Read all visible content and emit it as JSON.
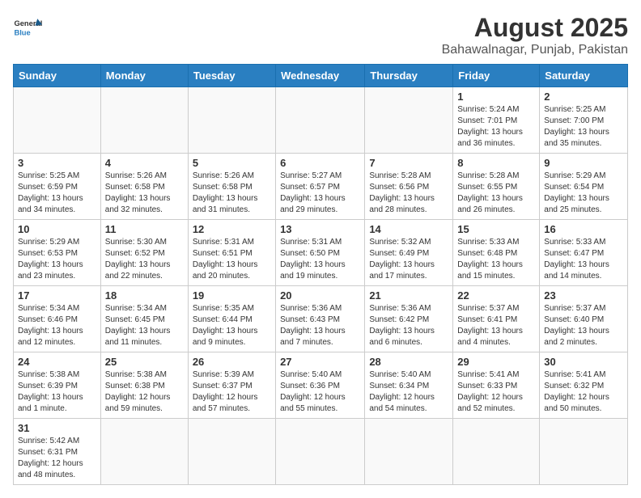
{
  "header": {
    "title": "August 2025",
    "subtitle": "Bahawalnagar, Punjab, Pakistan",
    "logo_general": "General",
    "logo_blue": "Blue"
  },
  "weekdays": [
    "Sunday",
    "Monday",
    "Tuesday",
    "Wednesday",
    "Thursday",
    "Friday",
    "Saturday"
  ],
  "weeks": [
    [
      {
        "day": null,
        "info": null
      },
      {
        "day": null,
        "info": null
      },
      {
        "day": null,
        "info": null
      },
      {
        "day": null,
        "info": null
      },
      {
        "day": null,
        "info": null
      },
      {
        "day": "1",
        "info": "Sunrise: 5:24 AM\nSunset: 7:01 PM\nDaylight: 13 hours and 36 minutes."
      },
      {
        "day": "2",
        "info": "Sunrise: 5:25 AM\nSunset: 7:00 PM\nDaylight: 13 hours and 35 minutes."
      }
    ],
    [
      {
        "day": "3",
        "info": "Sunrise: 5:25 AM\nSunset: 6:59 PM\nDaylight: 13 hours and 34 minutes."
      },
      {
        "day": "4",
        "info": "Sunrise: 5:26 AM\nSunset: 6:58 PM\nDaylight: 13 hours and 32 minutes."
      },
      {
        "day": "5",
        "info": "Sunrise: 5:26 AM\nSunset: 6:58 PM\nDaylight: 13 hours and 31 minutes."
      },
      {
        "day": "6",
        "info": "Sunrise: 5:27 AM\nSunset: 6:57 PM\nDaylight: 13 hours and 29 minutes."
      },
      {
        "day": "7",
        "info": "Sunrise: 5:28 AM\nSunset: 6:56 PM\nDaylight: 13 hours and 28 minutes."
      },
      {
        "day": "8",
        "info": "Sunrise: 5:28 AM\nSunset: 6:55 PM\nDaylight: 13 hours and 26 minutes."
      },
      {
        "day": "9",
        "info": "Sunrise: 5:29 AM\nSunset: 6:54 PM\nDaylight: 13 hours and 25 minutes."
      }
    ],
    [
      {
        "day": "10",
        "info": "Sunrise: 5:29 AM\nSunset: 6:53 PM\nDaylight: 13 hours and 23 minutes."
      },
      {
        "day": "11",
        "info": "Sunrise: 5:30 AM\nSunset: 6:52 PM\nDaylight: 13 hours and 22 minutes."
      },
      {
        "day": "12",
        "info": "Sunrise: 5:31 AM\nSunset: 6:51 PM\nDaylight: 13 hours and 20 minutes."
      },
      {
        "day": "13",
        "info": "Sunrise: 5:31 AM\nSunset: 6:50 PM\nDaylight: 13 hours and 19 minutes."
      },
      {
        "day": "14",
        "info": "Sunrise: 5:32 AM\nSunset: 6:49 PM\nDaylight: 13 hours and 17 minutes."
      },
      {
        "day": "15",
        "info": "Sunrise: 5:33 AM\nSunset: 6:48 PM\nDaylight: 13 hours and 15 minutes."
      },
      {
        "day": "16",
        "info": "Sunrise: 5:33 AM\nSunset: 6:47 PM\nDaylight: 13 hours and 14 minutes."
      }
    ],
    [
      {
        "day": "17",
        "info": "Sunrise: 5:34 AM\nSunset: 6:46 PM\nDaylight: 13 hours and 12 minutes."
      },
      {
        "day": "18",
        "info": "Sunrise: 5:34 AM\nSunset: 6:45 PM\nDaylight: 13 hours and 11 minutes."
      },
      {
        "day": "19",
        "info": "Sunrise: 5:35 AM\nSunset: 6:44 PM\nDaylight: 13 hours and 9 minutes."
      },
      {
        "day": "20",
        "info": "Sunrise: 5:36 AM\nSunset: 6:43 PM\nDaylight: 13 hours and 7 minutes."
      },
      {
        "day": "21",
        "info": "Sunrise: 5:36 AM\nSunset: 6:42 PM\nDaylight: 13 hours and 6 minutes."
      },
      {
        "day": "22",
        "info": "Sunrise: 5:37 AM\nSunset: 6:41 PM\nDaylight: 13 hours and 4 minutes."
      },
      {
        "day": "23",
        "info": "Sunrise: 5:37 AM\nSunset: 6:40 PM\nDaylight: 13 hours and 2 minutes."
      }
    ],
    [
      {
        "day": "24",
        "info": "Sunrise: 5:38 AM\nSunset: 6:39 PM\nDaylight: 13 hours and 1 minute."
      },
      {
        "day": "25",
        "info": "Sunrise: 5:38 AM\nSunset: 6:38 PM\nDaylight: 12 hours and 59 minutes."
      },
      {
        "day": "26",
        "info": "Sunrise: 5:39 AM\nSunset: 6:37 PM\nDaylight: 12 hours and 57 minutes."
      },
      {
        "day": "27",
        "info": "Sunrise: 5:40 AM\nSunset: 6:36 PM\nDaylight: 12 hours and 55 minutes."
      },
      {
        "day": "28",
        "info": "Sunrise: 5:40 AM\nSunset: 6:34 PM\nDaylight: 12 hours and 54 minutes."
      },
      {
        "day": "29",
        "info": "Sunrise: 5:41 AM\nSunset: 6:33 PM\nDaylight: 12 hours and 52 minutes."
      },
      {
        "day": "30",
        "info": "Sunrise: 5:41 AM\nSunset: 6:32 PM\nDaylight: 12 hours and 50 minutes."
      }
    ],
    [
      {
        "day": "31",
        "info": "Sunrise: 5:42 AM\nSunset: 6:31 PM\nDaylight: 12 hours and 48 minutes."
      },
      {
        "day": null,
        "info": null
      },
      {
        "day": null,
        "info": null
      },
      {
        "day": null,
        "info": null
      },
      {
        "day": null,
        "info": null
      },
      {
        "day": null,
        "info": null
      },
      {
        "day": null,
        "info": null
      }
    ]
  ]
}
